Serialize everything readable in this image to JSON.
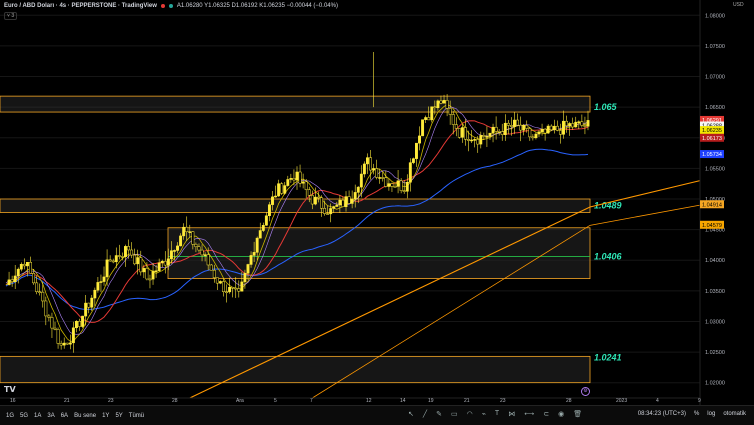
{
  "legend": {
    "symbol": "Euro / ABD Doları · 4s · PEPPERSTONE · TradingView",
    "values": "A1.06280 Y1.06325 D1.06192 K1.06235 −0.00044 (−0.04%)",
    "toggle": "3"
  },
  "currency": "USD",
  "price_axis": {
    "ticks": [
      "1.08000",
      "1.07500",
      "1.07000",
      "1.06500",
      "1.06000",
      "1.05500",
      "1.05000",
      "1.04500",
      "1.04000",
      "1.03500",
      "1.03000",
      "1.02500",
      "1.02000"
    ],
    "tags": [
      {
        "text": "1.06291",
        "bg": "#e53935",
        "fg": "#ffffff",
        "price": 1.06291
      },
      {
        "text": "1.06288",
        "bg": "#f5f5f5",
        "fg": "#000000",
        "price": 1.062
      },
      {
        "text": "1.06235",
        "bg": "#f2e600",
        "fg": "#000000",
        "price": 1.06125
      },
      {
        "text": "1.06173",
        "bg": "#b71c1c",
        "fg": "#ffffff",
        "price": 1.06
      },
      {
        "text": "1.05734",
        "bg": "#1e40ff",
        "fg": "#ffffff",
        "price": 1.05734
      },
      {
        "text": "1.04914",
        "bg": "#f5a623",
        "fg": "#000000",
        "price": 1.04914
      },
      {
        "text": "1.04579",
        "bg": "#f7a600",
        "fg": "#000000",
        "price": 1.04579
      }
    ]
  },
  "time_axis": [
    "16",
    "21",
    "23",
    "28",
    "Ara",
    "5",
    "7",
    "12",
    "14",
    "19",
    "21",
    "23",
    "28",
    "2023",
    "4",
    "9",
    "11"
  ],
  "levels": [
    {
      "label": "1.065",
      "price": 1.065
    },
    {
      "label": "1.0489",
      "price": 1.0489
    },
    {
      "label": "1.0406",
      "price": 1.0406
    },
    {
      "label": "1.0241",
      "price": 1.0241
    }
  ],
  "bottombar": {
    "timeframes": [
      "1G",
      "5G",
      "1A",
      "3A",
      "6A",
      "Bu sene",
      "1Y",
      "5Y",
      "Tümü"
    ],
    "clock": "08:34:23 (UTC+3)",
    "percent": "%",
    "log": "log",
    "auto": "otomatik"
  },
  "chart_data": {
    "type": "candlestick",
    "symbol": "EURUSD",
    "ylim": [
      1.0175,
      1.0825
    ],
    "colors": {
      "up": "#ffeb3b",
      "down": "#ffeb3b",
      "zones": "#f5a623",
      "ma_red": "#e53935",
      "ma_blue": "#2962ff",
      "ma_orange": "#ff9800"
    },
    "anchors": [
      [
        0,
        1.036
      ],
      [
        6,
        1.04
      ],
      [
        12,
        1.033
      ],
      [
        18,
        1.026
      ],
      [
        22,
        1.028
      ],
      [
        28,
        1.034
      ],
      [
        34,
        1.04
      ],
      [
        40,
        1.042
      ],
      [
        46,
        1.037
      ],
      [
        52,
        1.04
      ],
      [
        58,
        1.045
      ],
      [
        64,
        1.041
      ],
      [
        70,
        1.036
      ],
      [
        76,
        1.034
      ],
      [
        82,
        1.044
      ],
      [
        88,
        1.051
      ],
      [
        94,
        1.054
      ],
      [
        100,
        1.05
      ],
      [
        106,
        1.048
      ],
      [
        112,
        1.05
      ],
      [
        118,
        1.056
      ],
      [
        124,
        1.053
      ],
      [
        130,
        1.052
      ],
      [
        136,
        1.063
      ],
      [
        142,
        1.066
      ],
      [
        148,
        1.061
      ],
      [
        154,
        1.06
      ],
      [
        160,
        1.061
      ],
      [
        166,
        1.062
      ],
      [
        172,
        1.06
      ],
      [
        178,
        1.061
      ],
      [
        184,
        1.062
      ],
      [
        190,
        1.062
      ]
    ]
  }
}
